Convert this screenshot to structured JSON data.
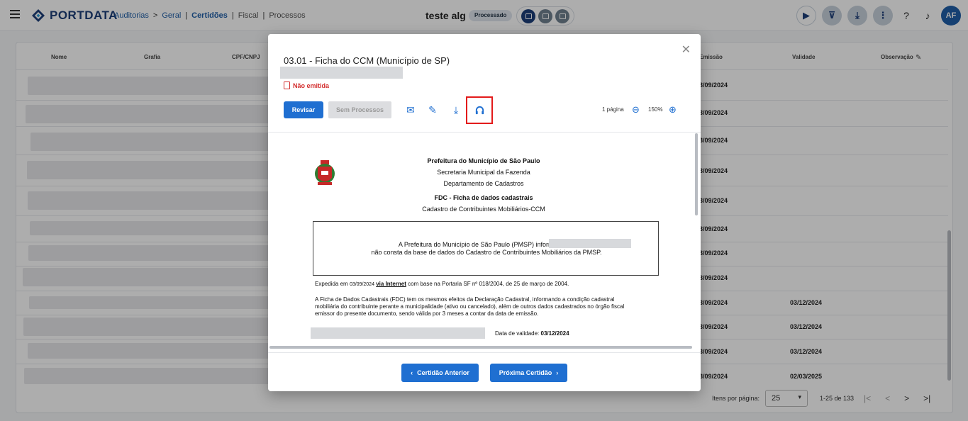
{
  "topbar": {
    "logo_text": "PORTDATA",
    "breadcrumbs": [
      "Auditorias",
      "Geral",
      "Certidões",
      "Fiscal",
      "Processos"
    ],
    "project_title": "teste alg",
    "status_badge": "Processado",
    "avatar_initials": "AF"
  },
  "table": {
    "headers": [
      "Nome",
      "Grafia",
      "CPF/CNPJ",
      "Emissão",
      "Validade",
      "Observação"
    ],
    "rows": [
      {
        "emissao": "3/09/2024",
        "validade": ""
      },
      {
        "emissao": "3/09/2024",
        "validade": ""
      },
      {
        "emissao": "3/09/2024",
        "validade": ""
      },
      {
        "emissao": "3/09/2024",
        "validade": ""
      },
      {
        "emissao": "3/09/2024",
        "validade": ""
      },
      {
        "emissao": "3/09/2024",
        "validade": ""
      },
      {
        "emissao": "3/09/2024",
        "validade": ""
      },
      {
        "emissao": "3/09/2024",
        "validade": ""
      },
      {
        "emissao": "3/09/2024",
        "validade": "03/12/2024"
      },
      {
        "emissao": "3/09/2024",
        "validade": "03/12/2024"
      },
      {
        "emissao": "3/09/2024",
        "validade": "03/12/2024"
      },
      {
        "emissao": "3/09/2024",
        "validade": "02/03/2025"
      }
    ],
    "pager": {
      "items_per_page_label": "Itens por página:",
      "items_per_page": "25",
      "range": "1-25 de 133"
    }
  },
  "modal": {
    "title": "03.01 - Ficha do CCM (Município de SP)",
    "status": "Não emitida",
    "review_button": "Revisar",
    "no_process_button": "Sem Processos",
    "page_count": "1 página",
    "zoom": "150%",
    "prev_button": "Certidão Anterior",
    "next_button": "Próxima Certidão"
  },
  "document": {
    "header1": "Prefeitura do Município de São Paulo",
    "header2": "Secretaria Municipal da Fazenda",
    "header3": "Departamento de Cadastros",
    "header4": "FDC - Ficha de dados cadastrais",
    "header5": "Cadastro de Contribuintes Mobiliários-CCM",
    "box_line1": "A Prefeitura do Município de São Paulo (PMSP) informa que c",
    "box_line2": "não consta da base de dados do Cadastro de Contribuintes Mobiliários da PMSP.",
    "expedida_prefix": "Expedida em",
    "expedida_date": "03/09/2024",
    "expedida_via": "via Internet",
    "expedida_suffix": "com base na Portaria SF nº 018/2004, de 25 de março de 2004.",
    "fdc_paragraph": "A Ficha de Dados Cadastrais (FDC) tem os mesmos efeitos da Declaração Cadastral, informando a condição cadastral mobiliária do contribuinte perante a municipalidade (ativo ou cancelado), além de outros dados cadastrados no órgão fiscal emissor do presente documento, sendo válida por 3 meses a contar da data de emissão.",
    "validity_label": "Data de validade:",
    "validity_date": "03/12/2024"
  }
}
